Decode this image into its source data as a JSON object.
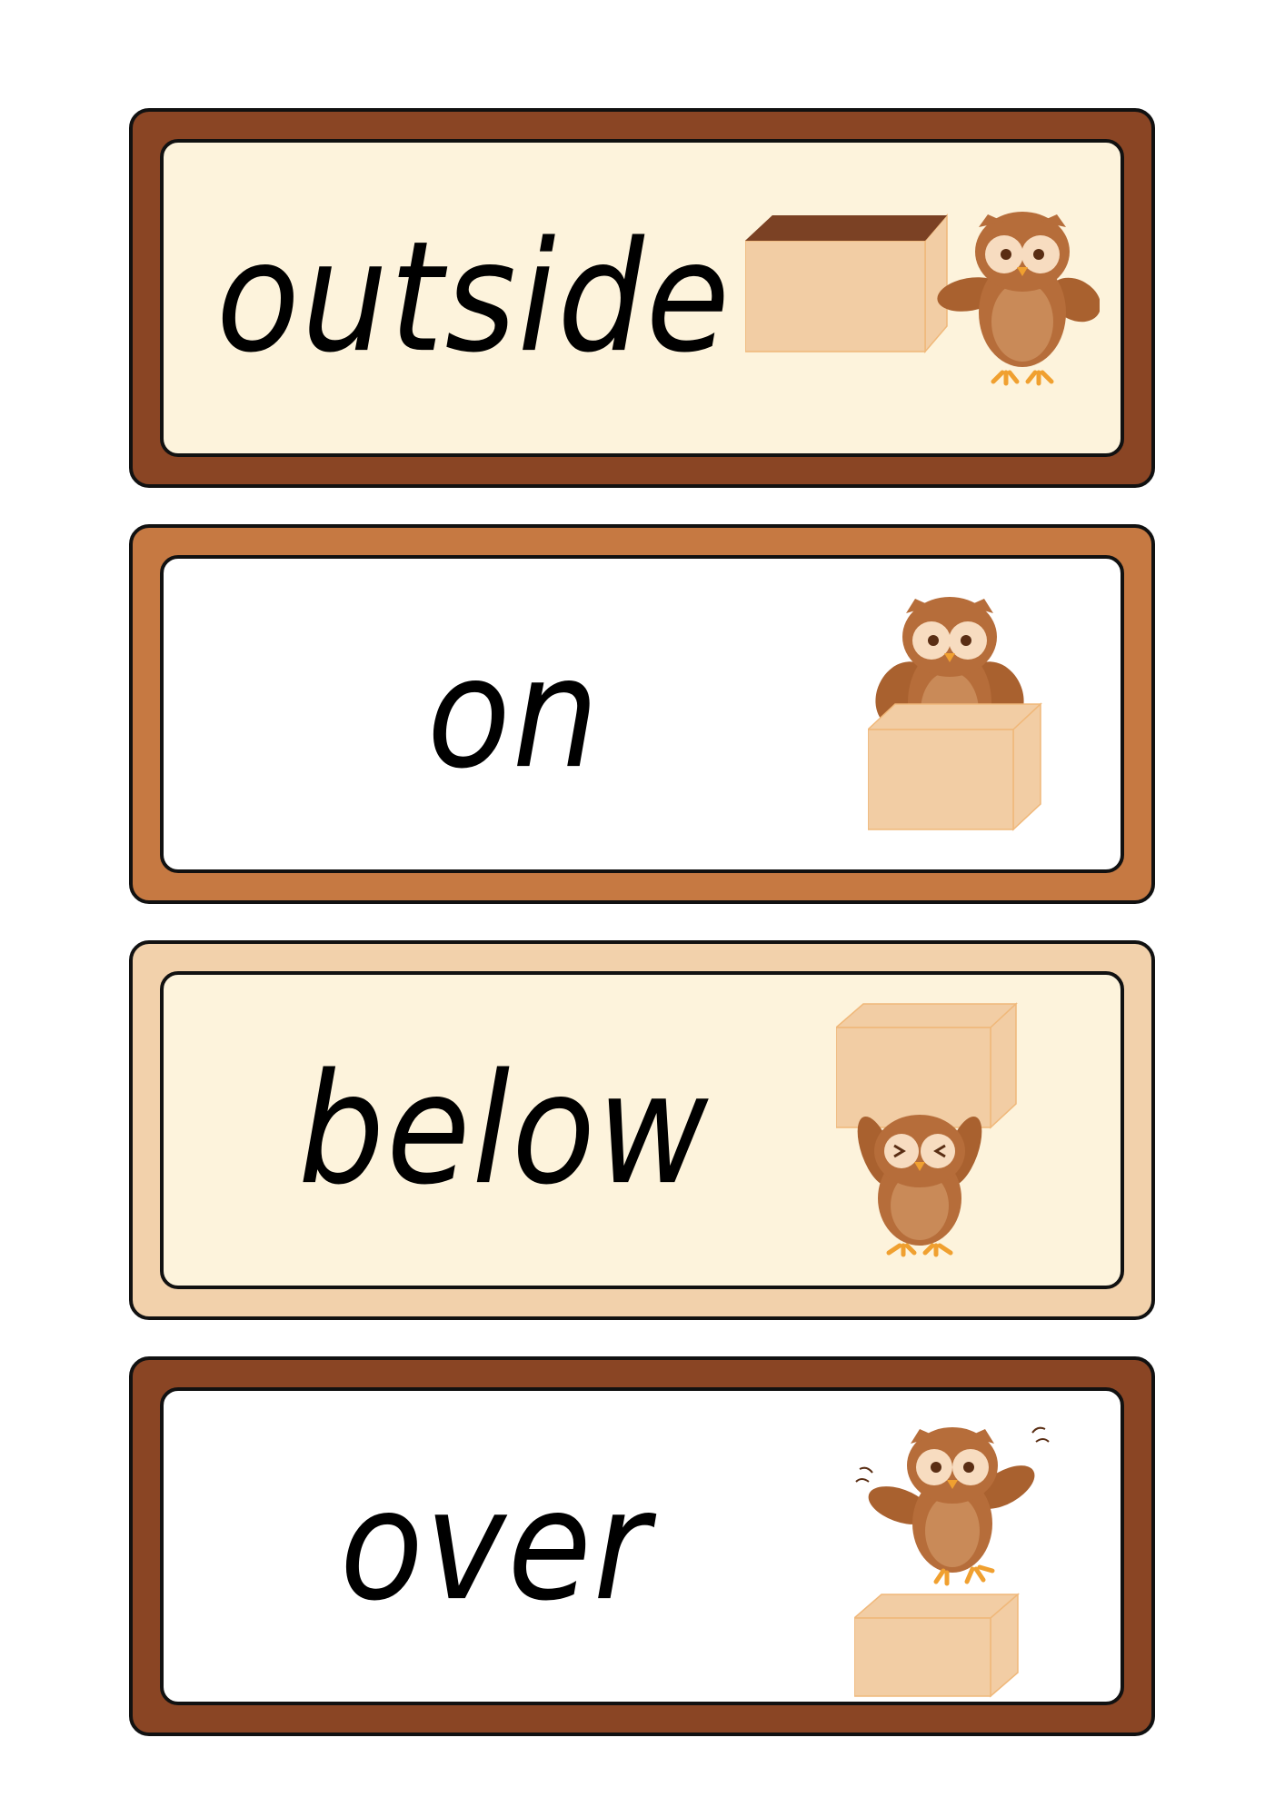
{
  "colors": {
    "dark_brown": "#8a4524",
    "mid_brown": "#c67942",
    "tan": "#f2d1ab",
    "cream": "#fdf3dc",
    "white": "#ffffff",
    "box_front": "#f2cda4",
    "box_top_dark": "#7b4124",
    "owl_body": "#b66d3a"
  },
  "cards": [
    {
      "word": "outside",
      "illustration": "owl-beside-box-icon"
    },
    {
      "word": "on",
      "illustration": "owl-on-box-icon"
    },
    {
      "word": "below",
      "illustration": "owl-below-box-icon"
    },
    {
      "word": "over",
      "illustration": "owl-over-box-icon"
    }
  ]
}
